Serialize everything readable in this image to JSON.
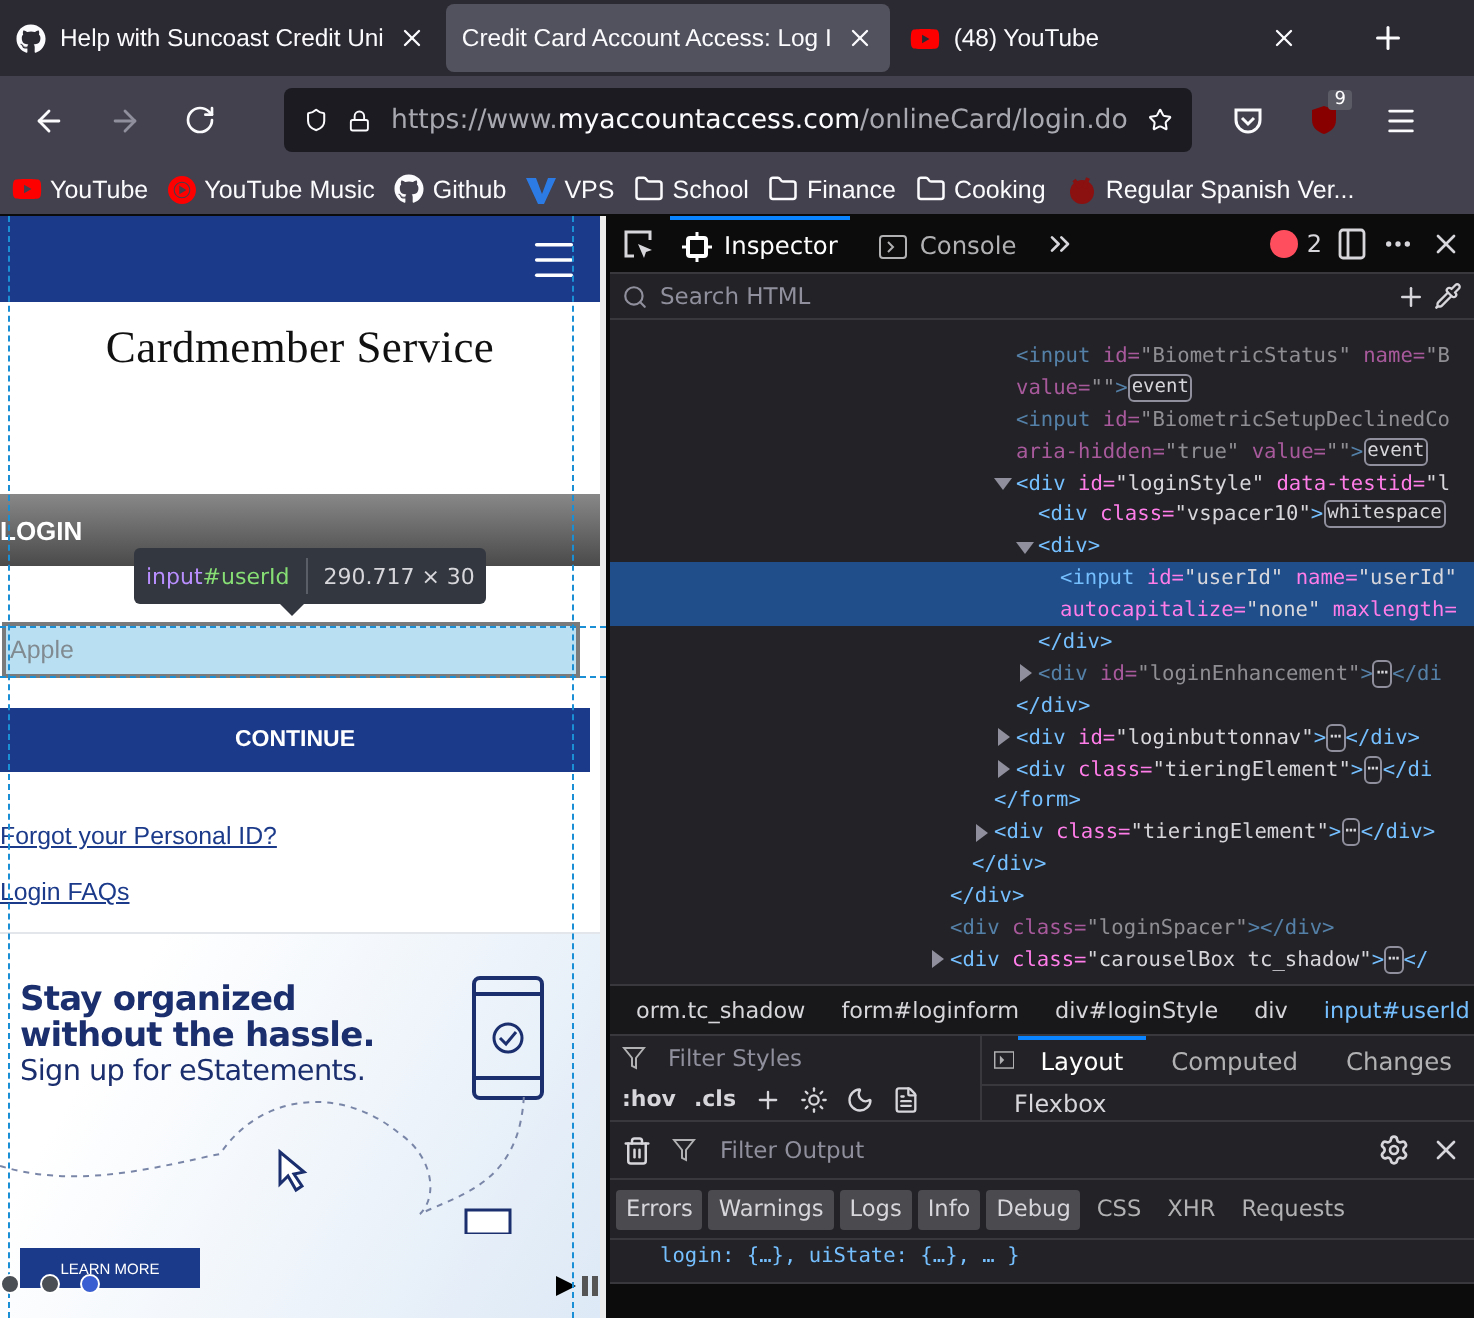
{
  "browser": {
    "tabs": [
      {
        "title": "Help with Suncoast Credit Uni",
        "kind": "github",
        "selected": false
      },
      {
        "title": "Credit Card Account Access: Log I",
        "selected": true
      },
      {
        "title": "(48) YouTube",
        "kind": "youtube",
        "selected": false
      }
    ],
    "url": {
      "prefix": "https://www.",
      "domain": "myaccountaccess.com",
      "path": "/onlineCard/login.do"
    },
    "extension_badge": "9",
    "bookmarks": [
      {
        "label": "YouTube",
        "kind": "youtube"
      },
      {
        "label": "YouTube Music",
        "kind": "ytmusic"
      },
      {
        "label": "Github",
        "kind": "github"
      },
      {
        "label": "VPS",
        "kind": "vps"
      },
      {
        "label": "School",
        "kind": "folder"
      },
      {
        "label": "Finance",
        "kind": "folder"
      },
      {
        "label": "Cooking",
        "kind": "folder"
      },
      {
        "label": "Regular Spanish Ver...",
        "kind": "spanish"
      }
    ]
  },
  "page": {
    "brand": "Cardmember Service",
    "login_header": "LOGIN",
    "tooltip": {
      "tag": "input",
      "id": "#userId",
      "size": "290.717 × 30"
    },
    "user_id_field": {
      "value": "Apple"
    },
    "continue_button": "CONTINUE",
    "links": [
      "Forgot your Personal ID?",
      "Login FAQs"
    ],
    "promo": {
      "headline": "Stay organized without the hassle.",
      "subline": "Sign up for eStatements.",
      "button": "LEARN MORE",
      "dots": [
        {
          "selected": false
        },
        {
          "selected": false
        },
        {
          "selected": true
        }
      ]
    }
  },
  "devtools": {
    "tabs": [
      {
        "label": "Inspector",
        "selected": true
      },
      {
        "label": "Console",
        "selected": false
      }
    ],
    "error_count": "2",
    "search": {
      "placeholder": "Search HTML"
    },
    "tree": [
      {
        "children": [
          {
            "children": [
              {
                "children": [
                  {
                    "lines": [
                      "<input id=\"BiometricStatus\" name=\"B",
                      "value=\"\">"
                    ],
                    "badge": "event",
                    "dim": true,
                    "selected": false
                  },
                  {
                    "lines": [
                      "<input id=\"BiometricSetupDeclinedCo",
                      "aria-hidden=\"true\" value=\"\">"
                    ],
                    "badge": "event",
                    "dim": true,
                    "selected": false
                  },
                  {
                    "lines": [
                      "<div id=\"loginStyle\" data-testid=\"l"
                    ],
                    "expanded": true,
                    "dim": false,
                    "selected": false,
                    "children": [
                      {
                        "lines": [
                          "<div class=\"vspacer10\">"
                        ],
                        "badge": "whitespace",
                        "dim": false,
                        "selected": false
                      },
                      {
                        "lines": [
                          "<div>"
                        ],
                        "expanded": true,
                        "dim": false,
                        "selected": false,
                        "children": [
                          {
                            "lines": [
                              "<input id=\"userId\" name=\"userId\"",
                              "autocapitalize=\"none\" maxlength="
                            ],
                            "dim": false,
                            "selected": true
                          }
                        ],
                        "close": "</div>"
                      },
                      {
                        "lines": [
                          "<div id=\"loginEnhancement\">"
                        ],
                        "badge": "⋯",
                        "tail": "</di",
                        "expanded": false,
                        "dim": true,
                        "selected": false
                      }
                    ],
                    "close": "</div>"
                  },
                  {
                    "lines": [
                      "<div id=\"loginbuttonnav\">"
                    ],
                    "badge": "⋯",
                    "tail": "</div>",
                    "expanded": false,
                    "dim": false,
                    "selected": false
                  },
                  {
                    "lines": [
                      "<div class=\"tieringElement\">"
                    ],
                    "badge": "⋯",
                    "tail": "</di",
                    "expanded": false,
                    "dim": false,
                    "selected": false
                  }
                ],
                "close": "</form>"
              },
              {
                "lines": [
                  "<div class=\"tieringElement\">"
                ],
                "badge": "⋯",
                "tail": "</div>",
                "expanded": false,
                "dim": false,
                "selected": false
              }
            ],
            "close": "</div>"
          }
        ],
        "close": "</div>"
      },
      {
        "lines": [
          "<div class=\"loginSpacer\"></div>"
        ],
        "dim": true,
        "selected": false
      },
      {
        "lines": [
          "<div class=\"carouselBox tc_shadow\">"
        ],
        "badge": "⋯",
        "tail": "</",
        "expanded": false,
        "dim": false,
        "selected": false
      }
    ],
    "breadcrumbs": [
      {
        "label": "orm.tc_shadow",
        "selected": false
      },
      {
        "label": "form#loginform",
        "selected": false
      },
      {
        "label": "div#loginStyle",
        "selected": false
      },
      {
        "label": "div",
        "selected": false
      },
      {
        "label": "input#userId",
        "selected": true
      }
    ],
    "styles": {
      "placeholder": "Filter Styles",
      "tools": [
        ":hov",
        ".cls"
      ]
    },
    "side_tabs": [
      {
        "label": "Layout",
        "selected": true
      },
      {
        "label": "Computed",
        "selected": false
      },
      {
        "label": "Changes",
        "selected": false
      }
    ],
    "section": "Flexbox",
    "console": {
      "placeholder": "Filter Output",
      "filters": [
        {
          "label": "Errors",
          "on": true
        },
        {
          "label": "Warnings",
          "on": true
        },
        {
          "label": "Logs",
          "on": true
        },
        {
          "label": "Info",
          "on": true
        },
        {
          "label": "Debug",
          "on": true
        },
        {
          "label": "CSS",
          "on": false
        },
        {
          "label": "XHR",
          "on": false
        },
        {
          "label": "Requests",
          "on": false
        }
      ],
      "output": "login: {…}, uiState: {…}, … }"
    }
  }
}
